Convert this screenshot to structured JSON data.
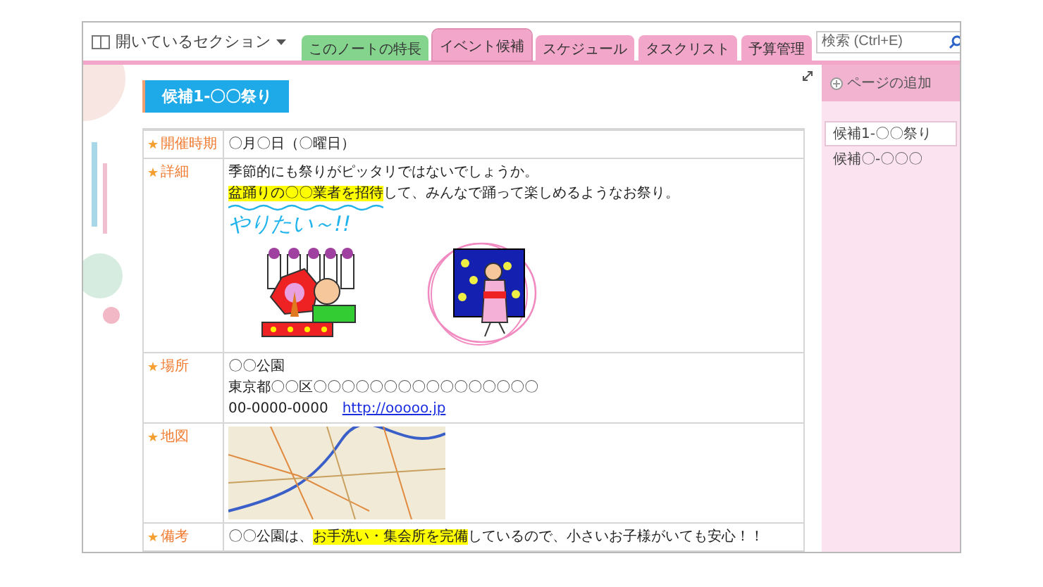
{
  "notebook": {
    "title": "開いているセクション"
  },
  "tabs": [
    {
      "label": "このノートの特長",
      "color": "#84d48e",
      "selected": false
    },
    {
      "label": "イベント候補",
      "color": "#f2a6c9",
      "selected": true
    },
    {
      "label": "スケジュール",
      "color": "#f2a6c9",
      "selected": false
    },
    {
      "label": "タスクリスト",
      "color": "#f2a6c9",
      "selected": false
    },
    {
      "label": "予算管理",
      "color": "#f2a6c9",
      "selected": false
    }
  ],
  "search": {
    "placeholder": "検索 (Ctrl+E)"
  },
  "page": {
    "title": "候補1-〇〇祭り",
    "rows": [
      {
        "label": "開催時期",
        "kind": "text",
        "lines": [
          [
            {
              "kind": "plain",
              "text": "〇月〇日（〇曜日）"
            }
          ]
        ]
      },
      {
        "label": "詳細",
        "kind": "detail",
        "lines": [
          [
            {
              "kind": "plain",
              "text": "季節的にも祭りがピッタリではないでしょうか。"
            }
          ],
          [
            {
              "kind": "highlight",
              "text": "盆踊りの〇〇業者を招待"
            },
            {
              "kind": "plain",
              "text": "して、みんなで踊って楽しめるようなお祭り。"
            }
          ]
        ],
        "handwriting": "やりたい～!!"
      },
      {
        "label": "場所",
        "kind": "text",
        "lines": [
          [
            {
              "kind": "plain",
              "text": "〇〇公園"
            }
          ],
          [
            {
              "kind": "plain",
              "text": "東京都〇〇区〇〇〇〇〇〇〇〇〇〇〇〇〇〇〇〇"
            }
          ],
          [
            {
              "kind": "plain",
              "text": "00-0000-0000"
            },
            {
              "kind": "link",
              "text": "http://ooooo.jp"
            }
          ]
        ]
      },
      {
        "label": "地図",
        "kind": "map",
        "lines": []
      },
      {
        "label": "備考",
        "kind": "text",
        "lines": [
          [
            {
              "kind": "plain",
              "text": "〇〇公園は、"
            },
            {
              "kind": "highlight",
              "text": "お手洗い・集会所を完備"
            },
            {
              "kind": "plain",
              "text": "しているので、小さいお子様がいても安心！！"
            }
          ]
        ]
      }
    ]
  },
  "sidebar": {
    "add_page": "ページの追加",
    "pages": [
      {
        "title": "候補1-〇〇祭り",
        "selected": true
      },
      {
        "title": "候補〇-〇〇〇",
        "selected": false
      }
    ]
  }
}
